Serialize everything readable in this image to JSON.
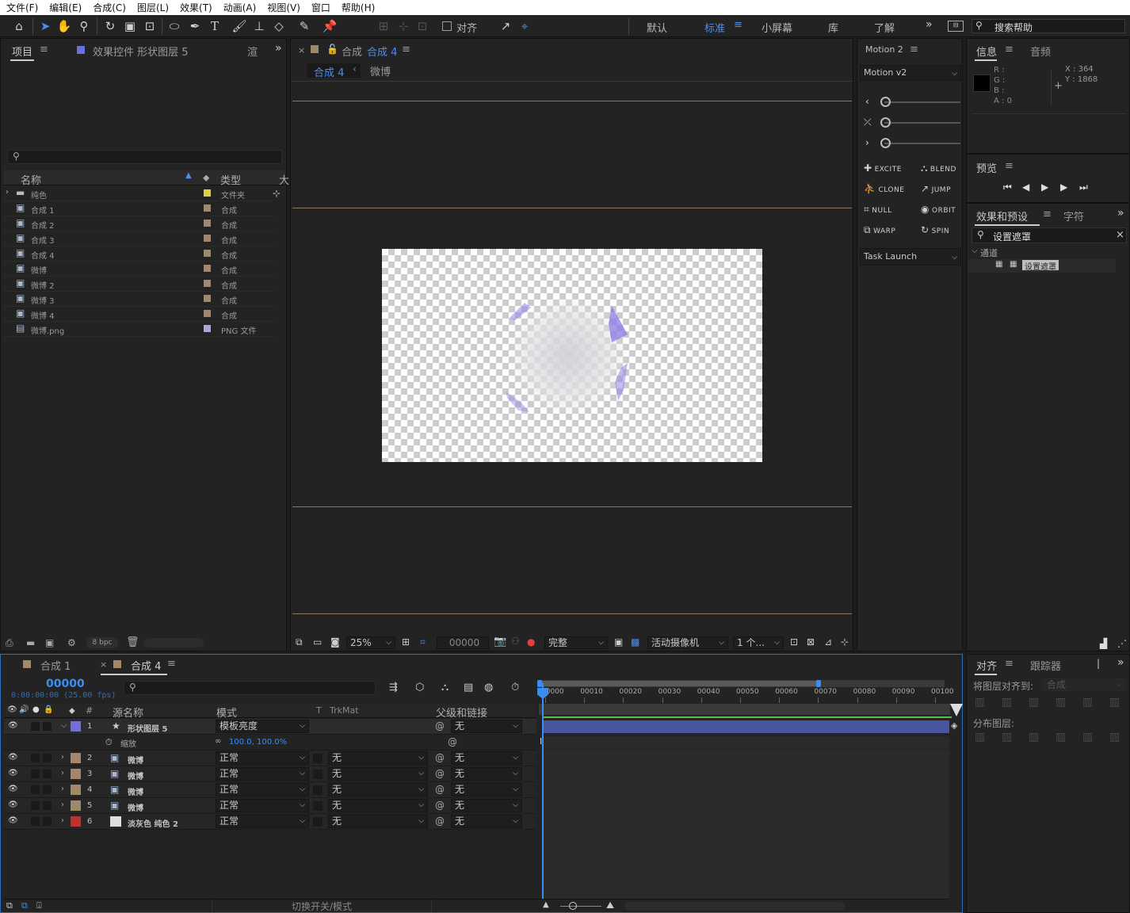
{
  "menu": [
    "文件(F)",
    "编辑(E)",
    "合成(C)",
    "图层(L)",
    "效果(T)",
    "动画(A)",
    "视图(V)",
    "窗口",
    "帮助(H)"
  ],
  "toolbar": {
    "snap_label": "对齐",
    "workspaces": [
      "默认",
      "标准",
      "小屏幕",
      "库",
      "了解"
    ],
    "active_workspace": "标准",
    "search_placeholder": "搜索帮助"
  },
  "project": {
    "tab": "项目",
    "effects_tab": "效果控件 形状图层 5",
    "render_tab": "渲",
    "col_name": "名称",
    "col_type": "类型",
    "col_size": "大",
    "items": [
      {
        "name": "纯色",
        "type": "文件夹",
        "color": "#e0d040",
        "kind": "folder"
      },
      {
        "name": "合成 1",
        "type": "合成",
        "color": "#a08868",
        "kind": "comp"
      },
      {
        "name": "合成 2",
        "type": "合成",
        "color": "#a08868",
        "kind": "comp"
      },
      {
        "name": "合成 3",
        "type": "合成",
        "color": "#a08868",
        "kind": "comp"
      },
      {
        "name": "合成 4",
        "type": "合成",
        "color": "#a08868",
        "kind": "comp"
      },
      {
        "name": "微博",
        "type": "合成",
        "color": "#a08868",
        "kind": "comp"
      },
      {
        "name": "微博 2",
        "type": "合成",
        "color": "#a08868",
        "kind": "comp"
      },
      {
        "name": "微博 3",
        "type": "合成",
        "color": "#a08868",
        "kind": "comp"
      },
      {
        "name": "微博 4",
        "type": "合成",
        "color": "#a08868",
        "kind": "comp"
      },
      {
        "name": "微博.png",
        "type": "PNG 文件",
        "color": "#a8a8d8",
        "kind": "file"
      }
    ],
    "bpc": "8 bpc"
  },
  "viewer": {
    "tab_prefix": "合成",
    "tab_comp": "合成 4",
    "crumb_active": "合成 4",
    "crumb_other": "微博",
    "zoom": "25%",
    "timecode": "00000",
    "quality": "完整",
    "camera": "活动摄像机",
    "views": "1 个..."
  },
  "motion": {
    "tab": "Motion 2",
    "version": "Motion v2",
    "buttons": [
      "EXCITE",
      "BLEND",
      "CLONE",
      "JUMP",
      "NULL",
      "ORBIT",
      "WARP",
      "SPIN"
    ],
    "task": "Task Launch"
  },
  "info": {
    "tab": "信息",
    "audio_tab": "音频",
    "r": "R :",
    "g": "G :",
    "b": "B :",
    "a": "A : 0",
    "x": "X : 364",
    "y": "Y : 1868"
  },
  "preview": {
    "tab": "预览"
  },
  "effects": {
    "tab": "效果和预设",
    "char_tab": "字符",
    "search": "设置遮罩",
    "group": "通道",
    "item": "设置遮罩"
  },
  "timeline": {
    "tab1": "合成 1",
    "tab2": "合成 4",
    "timecode": "00000",
    "timecode_sub": "0:00:00:00 (25.00 fps)",
    "headers": {
      "source": "源名称",
      "mode": "模式",
      "t": "T",
      "trkmat": "TrkMat",
      "parent": "父级和链接"
    },
    "ruler": [
      "00000",
      "00010",
      "00020",
      "00030",
      "00040",
      "00050",
      "00060",
      "00070",
      "00080",
      "00090",
      "00100"
    ],
    "layers": [
      {
        "num": "1",
        "name": "形状图层 5",
        "mode": "模板亮度",
        "trk": "",
        "parent": "无",
        "color": "#7070d8",
        "bar": "#4a55a0"
      },
      {
        "num": "2",
        "name": "微博",
        "mode": "正常",
        "trk": "无",
        "parent": "无",
        "color": "#a08868",
        "bar": "#7d705c"
      },
      {
        "num": "3",
        "name": "微博",
        "mode": "正常",
        "trk": "无",
        "parent": "无",
        "color": "#a08868",
        "bar": "#7d705c"
      },
      {
        "num": "4",
        "name": "微博",
        "mode": "正常",
        "trk": "无",
        "parent": "无",
        "color": "#a08868",
        "bar": "#7d705c"
      },
      {
        "num": "5",
        "name": "微博",
        "mode": "正常",
        "trk": "无",
        "parent": "无",
        "color": "#a08868",
        "bar": "#7d705c"
      },
      {
        "num": "6",
        "name": "淡灰色 纯色 2",
        "mode": "正常",
        "trk": "无",
        "parent": "无",
        "color": "#c03030",
        "bar": "#8c3a3a"
      }
    ],
    "scale_label": "缩放",
    "scale_value": "100.0, 100.0%",
    "toggle_label": "切换开关/模式"
  },
  "align": {
    "tab": "对齐",
    "tracker_tab": "跟踪器",
    "align_to_label": "将图层对齐到:",
    "align_to_value": "合成",
    "distribute_label": "分布图层:"
  }
}
